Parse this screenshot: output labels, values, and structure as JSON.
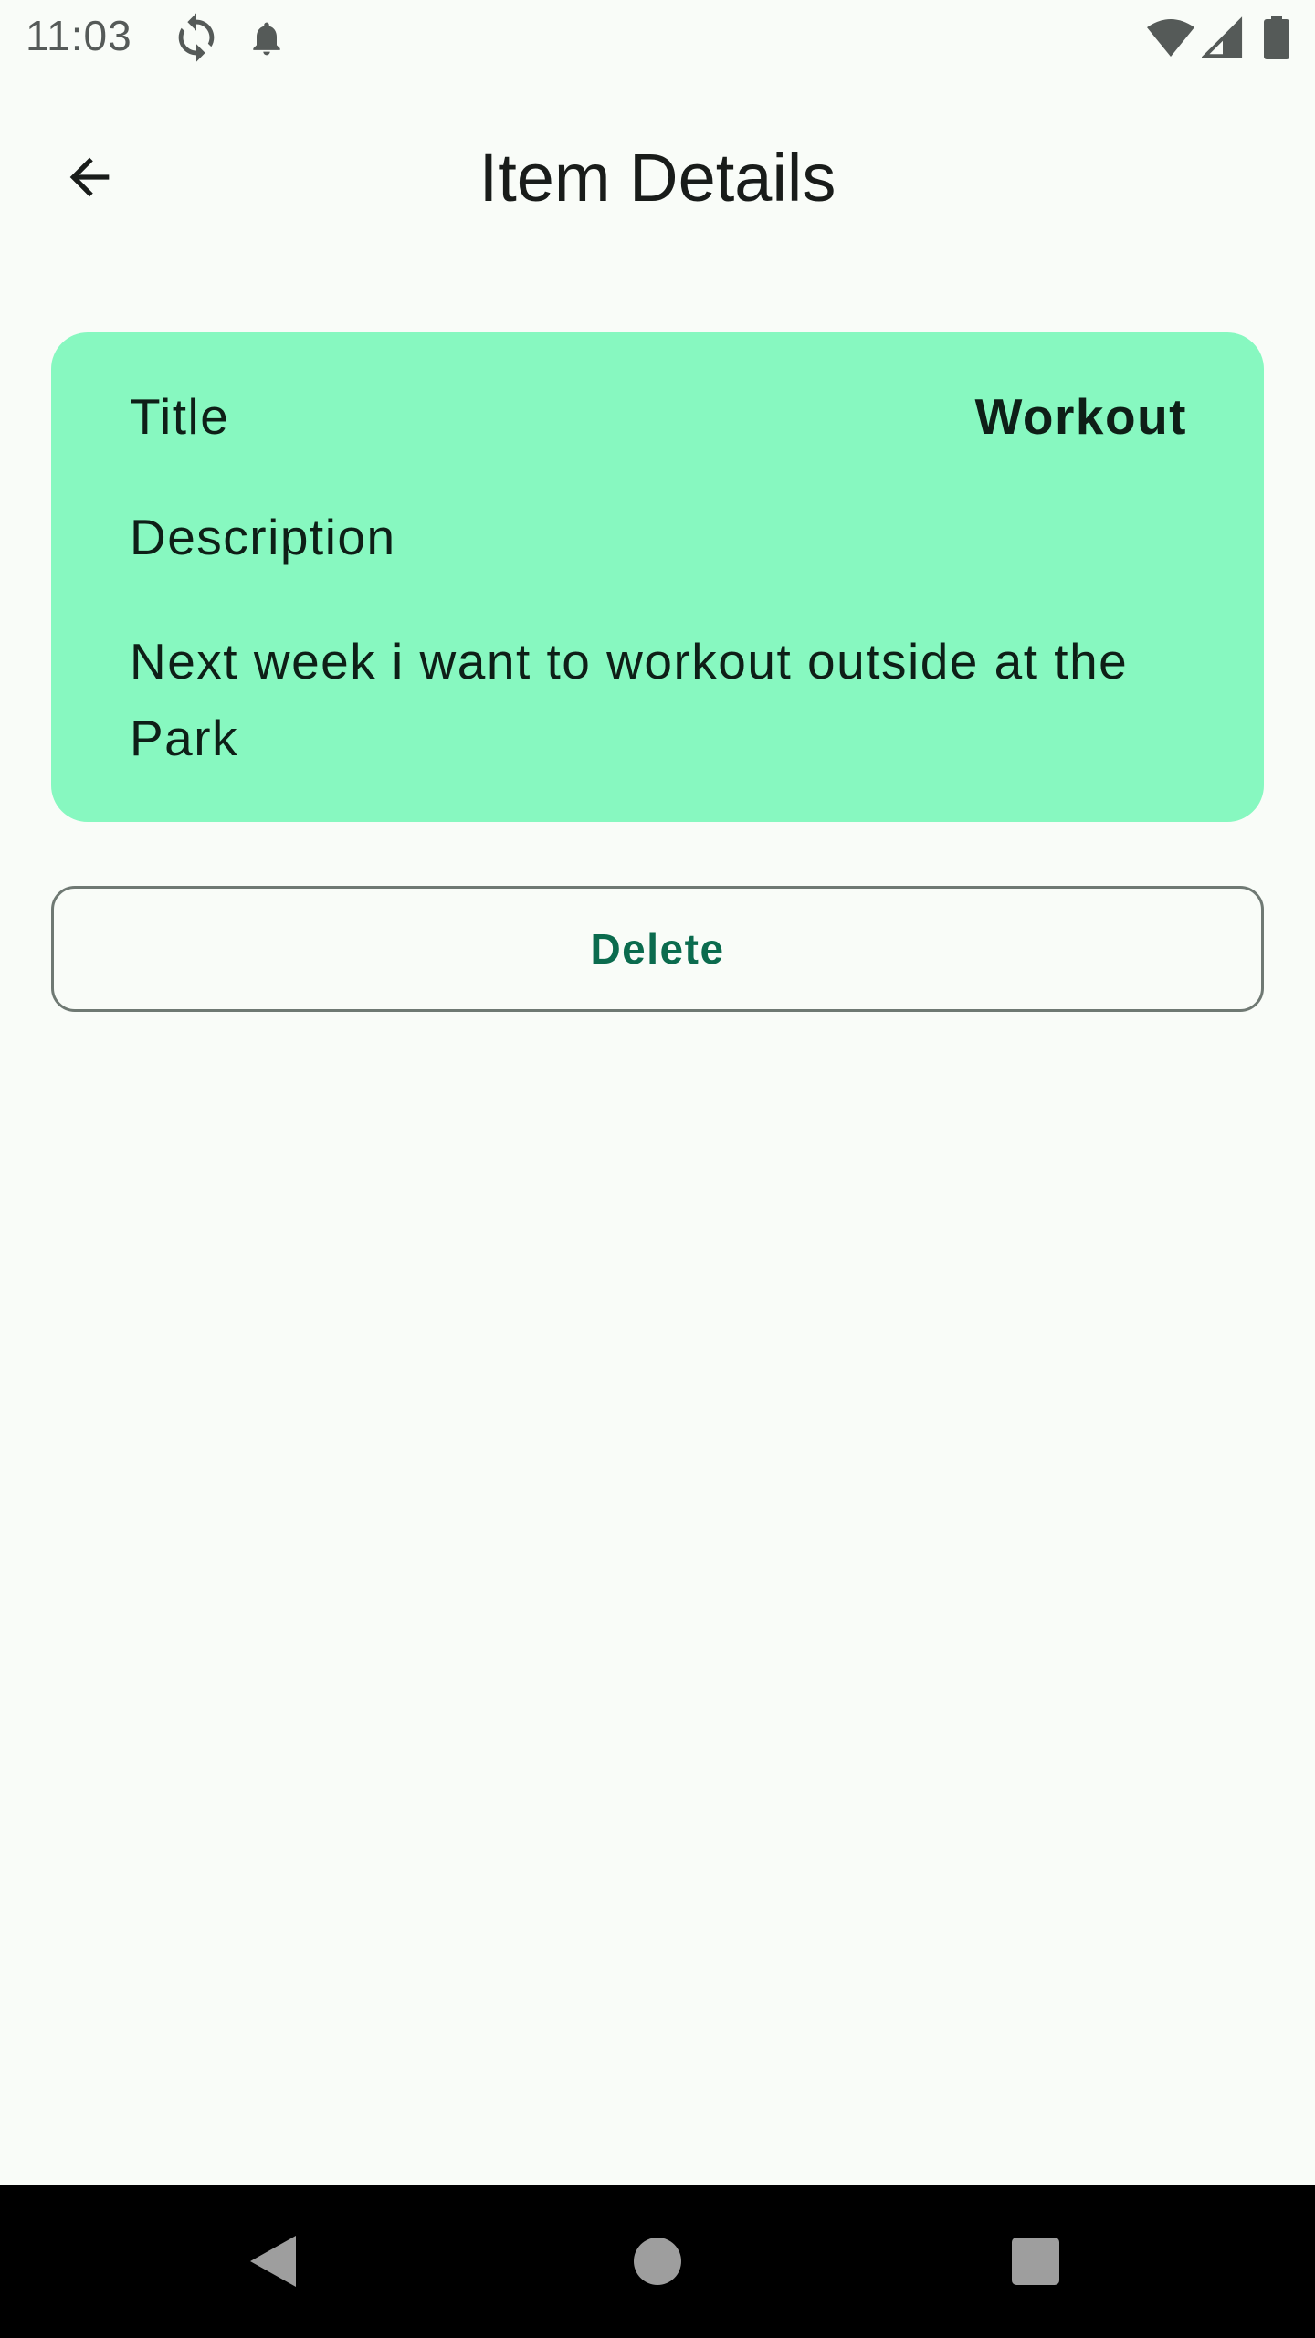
{
  "status_bar": {
    "time": "11:03",
    "icons": [
      "sync-icon",
      "bell-icon",
      "wifi-icon",
      "signal-icon",
      "battery-icon"
    ]
  },
  "top_bar": {
    "title": "Item Details",
    "back_icon": "arrow-left-icon"
  },
  "card": {
    "background_color": "#87F8C0",
    "title_label": "Title",
    "title_value": "Workout",
    "description_label": "Description",
    "description_text": "Next week i want to workout outside at the Park"
  },
  "actions": {
    "delete_label": "Delete",
    "accent_color": "#0B6B4E"
  },
  "nav_bar": {
    "icons": [
      "nav-back-icon",
      "nav-home-icon",
      "nav-recents-icon"
    ]
  }
}
